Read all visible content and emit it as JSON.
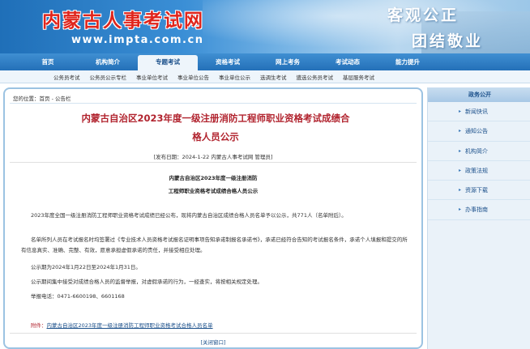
{
  "banner": {
    "site_title": "内蒙古人事考试网",
    "url": "www.impta.com.cn",
    "slogan_line1": "客观公正",
    "slogan_line2": "团结敬业"
  },
  "nav": {
    "items": [
      "首页",
      "机构简介",
      "专题考试",
      "资格考试",
      "网上考务",
      "考试动态",
      "能力提升"
    ],
    "active_index": 2
  },
  "subnav": {
    "items": [
      "公务员考试",
      "公务员公示专栏",
      "事业单位考试",
      "事业单位公告",
      "事业单位公示",
      "选调生考试",
      "遴选公务员考试",
      "基层服务考试"
    ]
  },
  "breadcrumb": {
    "prefix": "您的位置：",
    "home": "首页",
    "separator": " - ",
    "current": "公告栏"
  },
  "article": {
    "title_line1": "内蒙古自治区2023年度一级注册消防工程师职业资格考试成绩合",
    "title_line2": "格人员公示",
    "meta": "[发布日期：2024-1-22 内蒙古人事考试网 管理员]",
    "subtitle_line1": "内蒙古自治区2023年度一级注册消防",
    "subtitle_line2": "工程师职业资格考试成绩合格人员公示",
    "paragraphs": [
      "2023年度全国一级注册消防工程师职业资格考试成绩已经公布，现将内蒙古自治区成绩合格人员名单予以公示，共771人（名单附后）。",
      "名单所列人员在考试报名时均签署过《专业技术人员资格考试报名证明事项告知承诺制报名承诺书》，承诺已经符合告知的考试报名条件，承诺个人填报和提交的所有信息真实、准确、完整、有效，愿意承担虚假承诺的责任，并接受相应处理。",
      "公示期为2024年1月22日至2024年1月31日。",
      "公示期间集中接受对成绩合格人员的监督举报，对虚假承诺的行为，一经查实，将按相关规定处理。",
      "举报电话：0471-6600198、6601168"
    ],
    "attachment_label": "附件：",
    "attachment_link": "内蒙古自治区2023年度一级注册消防工程师职业资格考试合格人员名单",
    "close_label": "[关闭窗口]"
  },
  "sidebar": {
    "header": "政务公开",
    "items": [
      "新闻快讯",
      "通知公告",
      "机构简介",
      "政策法规",
      "资源下载",
      "办事指南"
    ]
  },
  "colors": {
    "brand_blue": "#2470b8",
    "title_red": "#b1232e",
    "link_blue": "#1a4f8a"
  }
}
